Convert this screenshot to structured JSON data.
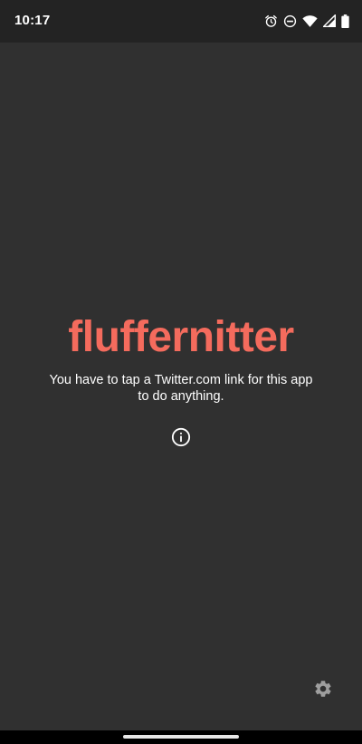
{
  "status_bar": {
    "time": "10:17",
    "icons": [
      "alarm-icon",
      "do-not-disturb-icon",
      "wifi-icon",
      "signal-icon",
      "battery-icon"
    ]
  },
  "main": {
    "app_title": "fluffernitter",
    "message": "You have to tap a Twitter.com link for this app to do anything.",
    "info_icon": "info-icon",
    "settings_icon": "gear-icon"
  },
  "colors": {
    "background": "#303030",
    "status_bar": "#232323",
    "accent": "#f46b5d",
    "text": "#ffffff",
    "settings_icon": "#9e9e9e"
  }
}
